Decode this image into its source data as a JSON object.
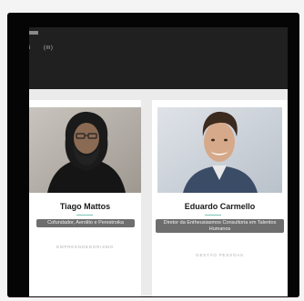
{
  "topbar": {
    "nav": [
      "i",
      "(m)"
    ]
  },
  "speakers": [
    {
      "name": "Tiago Mattos",
      "role": "Cofundador, Aerolito e Perestroika",
      "subtitle": "EMPREENDEDORISMO"
    },
    {
      "name": "Eduardo Carmello",
      "role": "Diretor da Entheusiasmos Consultoria em Talentos Humanos",
      "subtitle": "GESTÃO PESSOAS"
    }
  ],
  "colors": {
    "accent": "#7dc3b5",
    "role_badge": "#6e6e6e",
    "topbar": "#202020"
  }
}
